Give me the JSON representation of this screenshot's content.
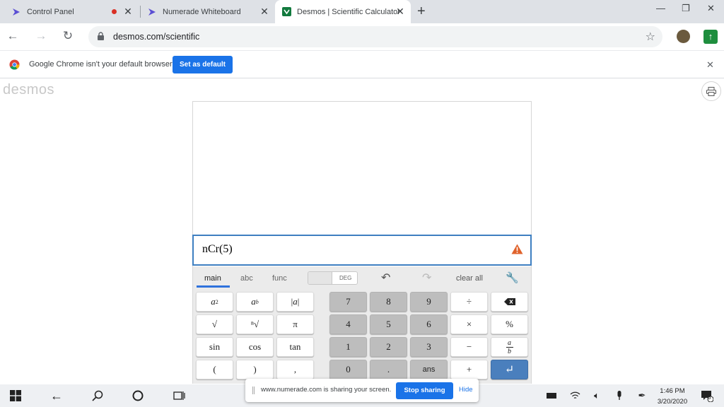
{
  "browser": {
    "tabs": [
      {
        "title": "Control Panel",
        "active": false
      },
      {
        "title": "Numerade Whiteboard",
        "active": false
      },
      {
        "title": "Desmos | Scientific Calculator",
        "active": true
      }
    ],
    "new_tab": "+",
    "url": "desmos.com/scientific"
  },
  "infobar": {
    "message": "Google Chrome isn't your default browser",
    "button": "Set as default"
  },
  "page": {
    "brand": "desmos",
    "expression": "nCr(5)"
  },
  "keypad": {
    "tabs": [
      "main",
      "abc",
      "func"
    ],
    "angle_mode": "DEG",
    "clear_all": "clear all",
    "rows": [
      [
        "a²",
        "aᵇ",
        "|a|",
        "7",
        "8",
        "9",
        "÷",
        "⌫"
      ],
      [
        "√",
        "ⁿ√",
        "π",
        "4",
        "5",
        "6",
        "×",
        "%"
      ],
      [
        "sin",
        "cos",
        "tan",
        "1",
        "2",
        "3",
        "−",
        "a/b"
      ],
      [
        "(",
        ")",
        ",",
        "0",
        ".",
        "ans",
        "+",
        "↵"
      ]
    ]
  },
  "share_bar": {
    "message": "www.numerade.com is sharing your screen.",
    "stop": "Stop sharing",
    "hide": "Hide"
  },
  "taskbar": {
    "time": "1:46 PM",
    "date": "3/20/2020",
    "notifications": "3"
  },
  "colors": {
    "accent": "#1a73e8",
    "desmos_blue": "#4a7fbd",
    "warning": "#e0622b"
  }
}
